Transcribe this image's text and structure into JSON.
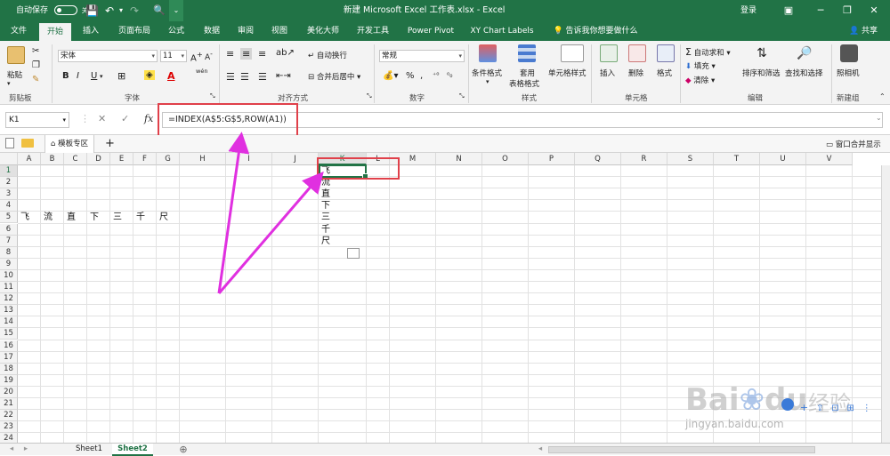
{
  "titlebar": {
    "autosave": "自动保存",
    "autosave_state": "关",
    "title": "新建 Microsoft Excel 工作表.xlsx - Excel",
    "login": "登录"
  },
  "tabs": [
    "文件",
    "开始",
    "插入",
    "页面布局",
    "公式",
    "数据",
    "审阅",
    "视图",
    "美化大师",
    "开发工具",
    "Power Pivot",
    "XY Chart Labels"
  ],
  "tell_me": "告诉我你想要做什么",
  "share": "共享",
  "ribbon": {
    "clipboard": {
      "paste": "粘贴",
      "label": "剪贴板"
    },
    "font": {
      "name": "宋体",
      "size": "11",
      "bold": "B",
      "italic": "I",
      "underline": "U",
      "label": "字体",
      "wen": "wén"
    },
    "align": {
      "wrap": "自动换行",
      "merge": "合并后居中",
      "label": "对齐方式"
    },
    "number": {
      "format": "常规",
      "label": "数字"
    },
    "styles": {
      "cond": "条件格式",
      "table1": "套用",
      "table2": "表格格式",
      "cell": "单元格样式",
      "label": "样式"
    },
    "cells": {
      "insert": "插入",
      "delete": "删除",
      "format": "格式",
      "label": "单元格"
    },
    "editing": {
      "autosum": "自动求和",
      "fill": "填充",
      "clear": "清除",
      "sort": "排序和筛选",
      "find": "查找和选择",
      "label": "编辑"
    },
    "camera": {
      "label": "照相机",
      "group": "新建组"
    }
  },
  "formula_bar": {
    "namebox": "K1",
    "cancel": "✕",
    "enter": "✓",
    "fx": "fx",
    "formula": "=INDEX(A$5:G$5,ROW(A1))"
  },
  "docbar": {
    "template": "模板专区",
    "plus": "+",
    "merge_window": "窗口合并显示"
  },
  "grid": {
    "columns": [
      "A",
      "B",
      "C",
      "D",
      "E",
      "F",
      "G",
      "H",
      "I",
      "J",
      "K",
      "L",
      "M",
      "N",
      "O",
      "P",
      "Q",
      "R",
      "S",
      "T",
      "U",
      "V"
    ],
    "rows": [
      "1",
      "2",
      "3",
      "4",
      "5",
      "6",
      "7",
      "8",
      "9",
      "10",
      "11",
      "12",
      "13",
      "14",
      "15",
      "16",
      "17",
      "18",
      "19",
      "20",
      "21",
      "22",
      "23",
      "24"
    ],
    "row5": [
      "飞",
      "流",
      "直",
      "下",
      "三",
      "千",
      "尺"
    ],
    "colK": [
      "飞",
      "流",
      "直",
      "下",
      "三",
      "千",
      "尺"
    ]
  },
  "sheets": [
    "Sheet1",
    "Sheet2"
  ],
  "watermark": {
    "brand": "Bai",
    "du": "du",
    "jy": "经验",
    "url": "jingyan.baidu.com"
  },
  "colors": {
    "excel_green": "#217346",
    "highlight_red": "#e0404a",
    "arrow_magenta": "#e030e0"
  }
}
